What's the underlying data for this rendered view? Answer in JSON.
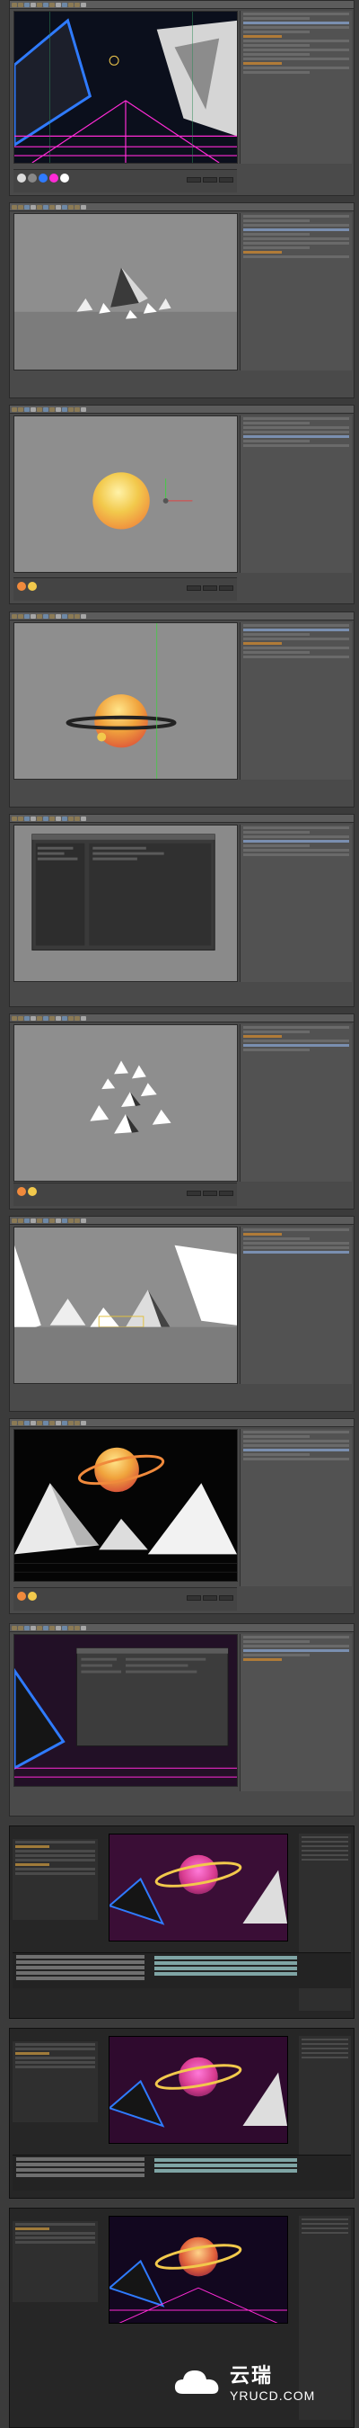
{
  "screenshots": [
    {
      "kind": "cinema4d",
      "scene": "neon-grid-pyramids"
    },
    {
      "kind": "cinema4d",
      "scene": "grey-pyramids"
    },
    {
      "kind": "cinema4d",
      "scene": "yellow-sphere"
    },
    {
      "kind": "cinema4d",
      "scene": "planet-with-ring"
    },
    {
      "kind": "cinema4d",
      "scene": "render-settings-dialog"
    },
    {
      "kind": "cinema4d",
      "scene": "scattered-pyramids"
    },
    {
      "kind": "cinema4d",
      "scene": "white-mountains"
    },
    {
      "kind": "cinema4d",
      "scene": "planet-over-mountains"
    },
    {
      "kind": "cinema4d",
      "scene": "neon-render-dialog"
    },
    {
      "kind": "after-effects",
      "scene": "magenta-planet-comp"
    },
    {
      "kind": "after-effects",
      "scene": "magenta-planet-comp-2"
    },
    {
      "kind": "after-effects",
      "scene": "final-neon-comp"
    }
  ],
  "colors": {
    "app_bg": "#3b3b3b",
    "neon_blue": "#2f7bff",
    "neon_magenta": "#ff2bd6",
    "planet_yellow": "#f2c94c",
    "planet_orange": "#f08a3c"
  },
  "watermark": {
    "cn": "云瑞",
    "en": "YRUCD.COM",
    "icon": "cloud-logo-icon"
  }
}
